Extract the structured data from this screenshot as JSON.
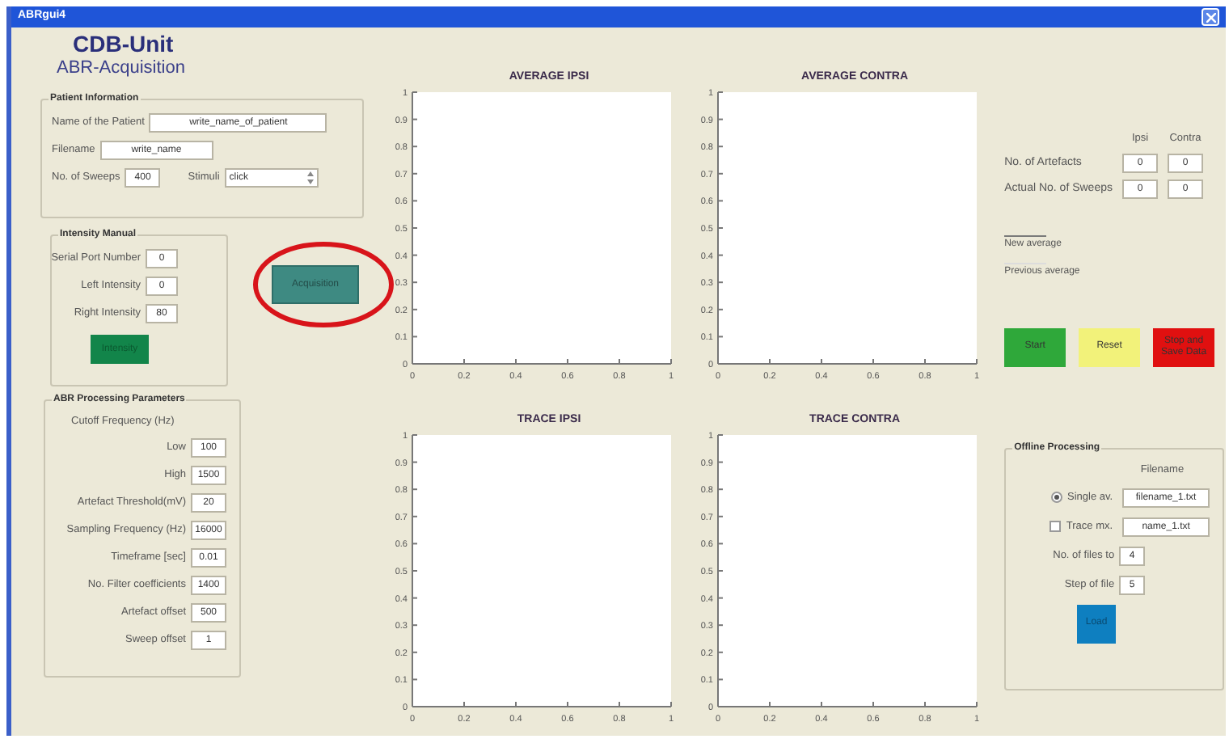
{
  "window": {
    "title": "ABRgui4"
  },
  "header": {
    "title": "CDB-Unit",
    "subtitle": "ABR-Acquisition"
  },
  "patient_panel": {
    "title": "Patient Information",
    "fields": [
      {
        "label": "Name of the Patient",
        "value": "write_name_of_patient"
      },
      {
        "label": "Filename",
        "value": "write_name"
      }
    ],
    "sweeps": {
      "label": "No. of Sweeps",
      "value": "400"
    },
    "stimuli": {
      "label": "Stimuli",
      "value": "click"
    }
  },
  "intensity_panel": {
    "title": "Intensity Manual",
    "fields": [
      {
        "label": "Serial Port Number",
        "value": "0"
      },
      {
        "label": "Left Intensity",
        "value": "0"
      },
      {
        "label": "Right Intensity",
        "value": "80"
      }
    ],
    "button": "Intensity"
  },
  "acquire_button": {
    "label": "Acquisition",
    "highlighted": true
  },
  "processing_panel": {
    "title": "ABR Processing Parameters",
    "heading": "Cutoff Frequency (Hz)",
    "fields": [
      {
        "label": "Low",
        "value": "100"
      },
      {
        "label": "High",
        "value": "1500"
      },
      {
        "label": "Artefact Threshold(mV)",
        "value": "20"
      },
      {
        "label": "Sampling Frequency (Hz)",
        "value": "16000"
      },
      {
        "label": "Timeframe [sec]",
        "value": "0.01"
      },
      {
        "label": "No. Filter coefficients",
        "value": "1400"
      },
      {
        "label": "Artefact offset",
        "value": "500"
      },
      {
        "label": "Sweep offset",
        "value": "1"
      }
    ]
  },
  "plots": [
    {
      "chart_data": {
        "type": "line",
        "title": "AVERAGE IPSI",
        "xlim": [
          0,
          1
        ],
        "ylim": [
          0,
          1
        ],
        "xticks": [
          0,
          0.2,
          0.4,
          0.6,
          0.8,
          1
        ],
        "yticks": [
          0,
          0.1,
          0.2,
          0.3,
          0.4,
          0.5,
          0.6,
          0.7,
          0.8,
          0.9,
          1
        ]
      }
    },
    {
      "chart_data": {
        "type": "line",
        "title": "AVERAGE CONTRA",
        "xlim": [
          0,
          1
        ],
        "ylim": [
          0,
          1
        ],
        "xticks": [
          0,
          0.2,
          0.4,
          0.6,
          0.8,
          1
        ],
        "yticks": [
          0,
          0.1,
          0.2,
          0.3,
          0.4,
          0.5,
          0.6,
          0.7,
          0.8,
          0.9,
          1
        ]
      }
    },
    {
      "chart_data": {
        "type": "line",
        "title": "TRACE IPSI",
        "xlim": [
          0,
          1
        ],
        "ylim": [
          0,
          1
        ],
        "xticks": [
          0,
          0.2,
          0.4,
          0.6,
          0.8,
          1
        ],
        "yticks": [
          0,
          0.1,
          0.2,
          0.3,
          0.4,
          0.5,
          0.6,
          0.7,
          0.8,
          0.9,
          1
        ]
      }
    },
    {
      "chart_data": {
        "type": "line",
        "title": "TRACE CONTRA",
        "xlim": [
          0,
          1
        ],
        "ylim": [
          0,
          1
        ],
        "xticks": [
          0,
          0.2,
          0.4,
          0.6,
          0.8,
          1
        ],
        "yticks": [
          0,
          0.1,
          0.2,
          0.3,
          0.4,
          0.5,
          0.6,
          0.7,
          0.8,
          0.9,
          1
        ]
      }
    }
  ],
  "counters": {
    "columns": [
      "Ipsi",
      "Contra"
    ],
    "rows": [
      {
        "label": "No. of Artefacts",
        "values": [
          "0",
          "0"
        ]
      },
      {
        "label": "Actual No. of Sweeps",
        "values": [
          "0",
          "0"
        ]
      }
    ]
  },
  "legend": [
    {
      "label": "New average",
      "color": "#7a7a7a"
    },
    {
      "label": "Previous average",
      "color": "#dcdcdc"
    }
  ],
  "controls": [
    {
      "label": "Start",
      "color": "#2fa83a"
    },
    {
      "label": "Reset",
      "color": "#f2f27a"
    },
    {
      "label": "Stop and Save Data",
      "color": "#e01010"
    }
  ],
  "offline_panel": {
    "title": "Offline Processing",
    "heading": "Filename",
    "options": [
      {
        "label": "Single av.",
        "selected": true,
        "kind": "radio",
        "value": "filename_1.txt"
      },
      {
        "label": "Trace mx.",
        "selected": false,
        "kind": "checkbox",
        "value": "name_1.txt"
      }
    ],
    "fields": [
      {
        "label": "No. of files to",
        "value": "4"
      },
      {
        "label": "Step of file",
        "value": "5"
      }
    ],
    "button": "Load"
  }
}
